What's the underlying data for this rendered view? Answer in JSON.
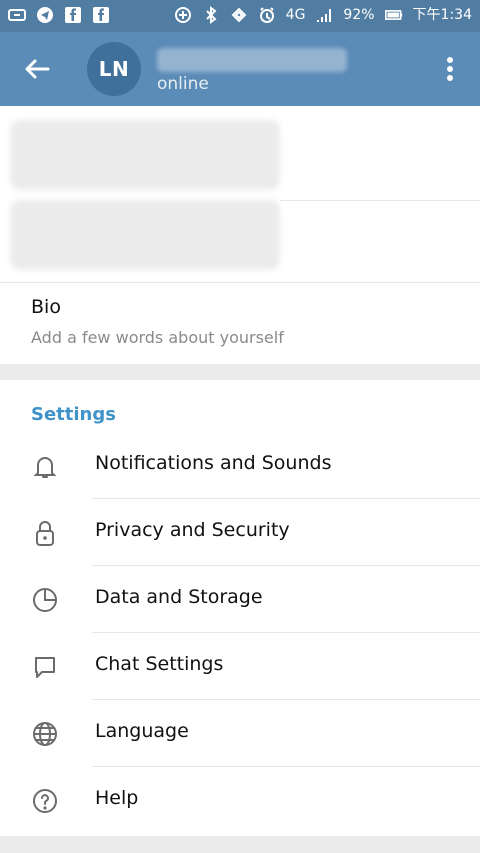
{
  "status_bar": {
    "battery": "92%",
    "time": "下午1:34",
    "network": "4G",
    "icons": [
      "sim-icon",
      "send-icon",
      "facebook-icon",
      "facebook-icon",
      "plus-circle-icon",
      "bluetooth-icon",
      "nfc-icon",
      "alarm-icon",
      "signal-icon",
      "battery-icon"
    ]
  },
  "app_bar": {
    "avatar_initials": "LN",
    "status": "online"
  },
  "profile": {
    "bio_title": "Bio",
    "bio_hint": "Add a few words about yourself"
  },
  "settings": {
    "title": "Settings",
    "items": [
      {
        "label": "Notifications and Sounds",
        "icon": "bell-icon"
      },
      {
        "label": "Privacy and Security",
        "icon": "lock-icon"
      },
      {
        "label": "Data and Storage",
        "icon": "pie-chart-icon"
      },
      {
        "label": "Chat Settings",
        "icon": "chat-bubble-icon"
      },
      {
        "label": "Language",
        "icon": "globe-icon"
      },
      {
        "label": "Help",
        "icon": "help-circle-icon"
      }
    ]
  },
  "colors": {
    "appbar": "#5b8bb7",
    "statusbar": "#517da2",
    "accent": "#3f93c8"
  }
}
